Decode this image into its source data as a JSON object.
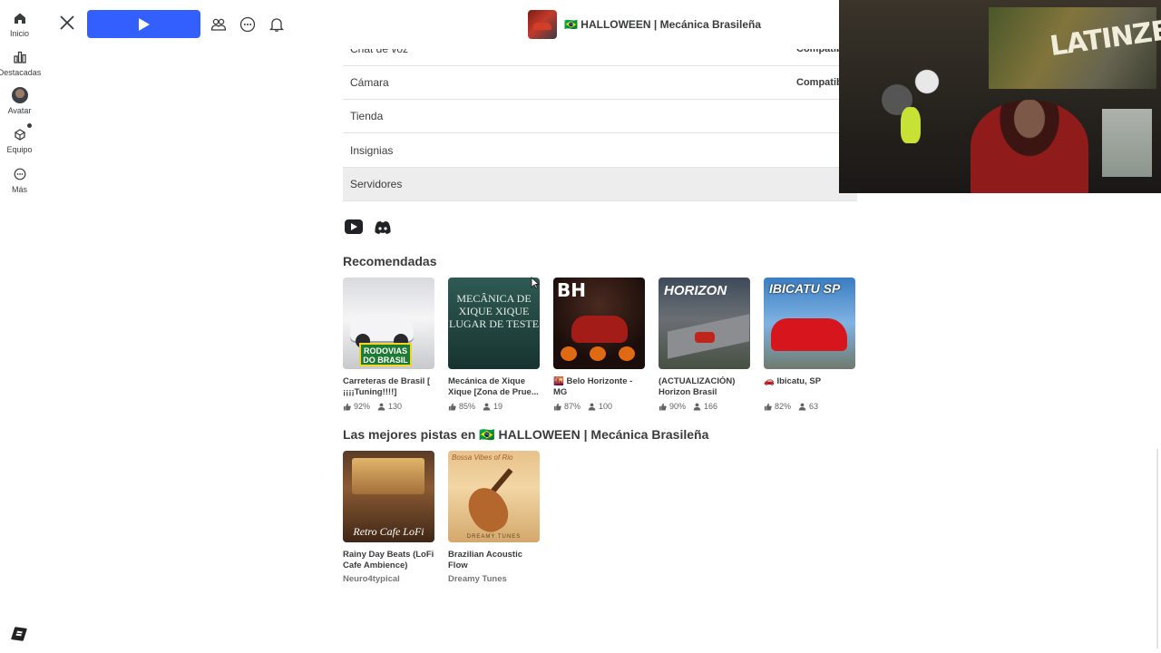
{
  "sidebar": {
    "items": [
      {
        "label": "Inicio",
        "icon": "home-icon"
      },
      {
        "label": "Destacadas",
        "icon": "chart-icon"
      },
      {
        "label": "Avatar",
        "icon": "avatar-icon"
      },
      {
        "label": "Equipo",
        "icon": "inventory-icon"
      },
      {
        "label": "Más",
        "icon": "more-icon"
      }
    ]
  },
  "topbar": {
    "game_title": "🇧🇷 HALLOWEEN | Mecánica Brasileña"
  },
  "info_rows": [
    {
      "label": "Chat de voz",
      "value": "Compatib"
    },
    {
      "label": "Cámara",
      "value": "Compatib"
    },
    {
      "label": "Tienda",
      "value": ""
    },
    {
      "label": "Insignias",
      "value": ""
    },
    {
      "label": "Servidores",
      "value": ""
    }
  ],
  "recommended": {
    "title": "Recomendadas",
    "cards": [
      {
        "name": "Carreteras de Brasil [ ¡¡¡¡Tuning!!!!]",
        "rating": "92%",
        "players": "130",
        "thumb_text": "RODOVIAS DO BRASIL"
      },
      {
        "name": "Mecánica de Xique Xique [Zona de Prue...",
        "rating": "85%",
        "players": "19",
        "thumb_text": "MECÂNICA DE XIQUE XIQUE LUGAR DE TESTE"
      },
      {
        "name": "🌇 Belo Horizonte - MG",
        "rating": "87%",
        "players": "100",
        "thumb_text": "BH"
      },
      {
        "name": "(ACTUALIZACIÓN) Horizon Brasil",
        "rating": "90%",
        "players": "166",
        "thumb_text": "HORIZON"
      },
      {
        "name": "🚗 Ibicatu, SP",
        "rating": "82%",
        "players": "63",
        "thumb_text": "IBICATU SP"
      }
    ]
  },
  "tracks": {
    "title": "Las mejores pistas en 🇧🇷 HALLOWEEN | Mecánica Brasileña",
    "cards": [
      {
        "name": "Rainy Day Beats (LoFi Cafe Ambience)",
        "artist": "Neuro4typical",
        "thumb_text": "Retro Cafe LoFi"
      },
      {
        "name": "Brazilian Acoustic Flow",
        "artist": "Dreamy Tunes",
        "thumb_text": "Bossa Vibes of Rio",
        "thumb_footer": "DREAMY TUNES"
      }
    ]
  },
  "webcam": {
    "graffiti_text": "LATINZERA"
  },
  "colors": {
    "play_button": "#335fff",
    "text": "#393b3d",
    "muted": "#757779",
    "active_row": "#ededed"
  }
}
